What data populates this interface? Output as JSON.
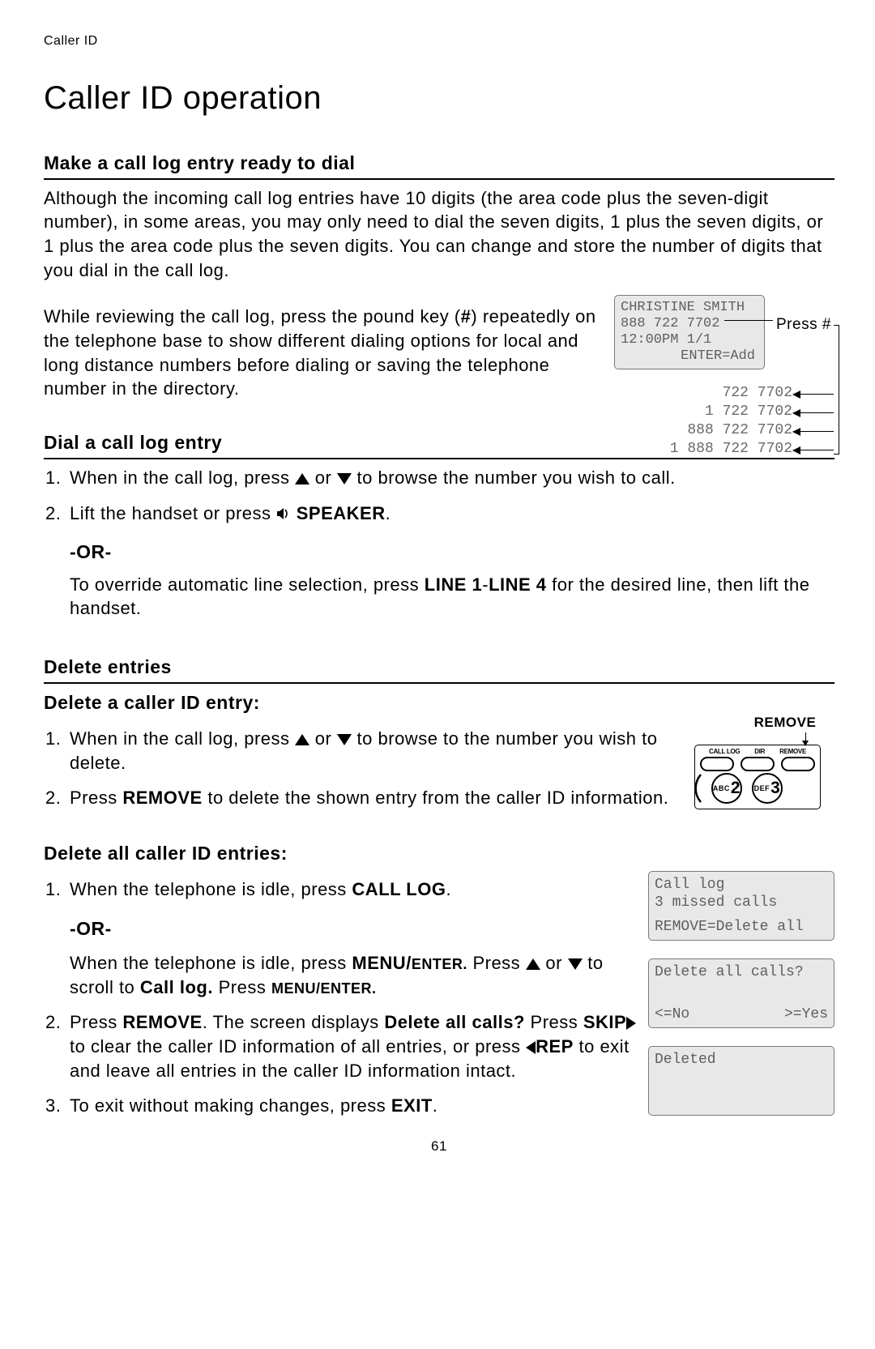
{
  "running_header": "Caller ID",
  "title": "Caller ID operation",
  "section1": {
    "heading": "Make a call log entry ready to dial",
    "para1": "Although the incoming call log entries have 10 digits (the area code plus the seven-digit number), in some areas, you may only need to dial the seven digits, 1 plus the seven digits, or 1 plus the area code plus the seven digits. You can change and store the number of digits that you dial in the call log.",
    "para2_pre": "While reviewing the call log, press the pound key (",
    "para2_pound": "#",
    "para2_post": ") repeatedly on the telephone base to show different dialing options for local and long distance numbers before dialing or saving the telephone number in the directory.",
    "press_label": "Press #"
  },
  "lcd1": {
    "line1": "CHRISTINE SMITH",
    "line2": "888 722 7702",
    "line3": "12:00PM 1/1",
    "line4": "ENTER=Add"
  },
  "dial_options": [
    "722 7702",
    "1 722 7702",
    "888 722 7702",
    "1 888 722 7702"
  ],
  "section2": {
    "heading": "Dial a call log entry",
    "step1_pre": "When in the call log, press ",
    "step1_mid": " or ",
    "step1_post": " to browse the number you wish to call.",
    "step2_pre": "Lift the handset or press ",
    "speaker_label": " SPEAKER",
    "step2_post": ".",
    "or": "-OR-",
    "step2b_pre": "To override automatic line selection, press ",
    "line_label": "LINE 1",
    "dash": "-",
    "line_label2": "LINE 4",
    "step2b_post": " for the desired line, then lift the handset."
  },
  "section3": {
    "heading": "Delete entries",
    "sub1": "Delete a caller ID entry:",
    "s1_step1_pre": "When in the call log, press ",
    "s1_step1_mid": " or ",
    "s1_step1_post": " to browse to the number you wish to delete.",
    "s1_step2_pre": "Press ",
    "remove_bold": "REMOVE",
    "s1_step2_post": " to delete the shown entry from the caller ID information.",
    "sub2": "Delete all caller ID entries:",
    "s2_step1_pre": "When the telephone is idle, press ",
    "calllog_bold": "CALL LOG",
    "s2_step1_post": ".",
    "or": "-OR-",
    "s2_step1b_pre": "When the telephone is idle, press ",
    "menu_enter_sc": "MENU/ENTER.",
    "s2_step1b_mid": " Press ",
    "s2_step1b_mid2": " or ",
    "s2_step1b_mid3": " to scroll to ",
    "calllog_bold2": "Call log.",
    "s2_step1b_post": " Press ",
    "menu_enter_sc2": "MENU/ENTER.",
    "s2_step2_pre": "Press ",
    "s2_step2_mid": ". The screen displays ",
    "delete_all_q": "Delete all calls?",
    "s2_step2_mid2": " Press ",
    "skip_bold": "SKIP",
    "s2_step2_mid3": " to clear the caller ID information of all entries, or press ",
    "rep_bold": "REP",
    "s2_step2_post": " to exit and leave all entries in the caller ID information intact.",
    "s2_step3_pre": "To exit without making changes, press ",
    "exit_bold": "EXIT",
    "s2_step3_post": "."
  },
  "keypad": {
    "remove_caption": "REMOVE",
    "labels": [
      "CALL LOG",
      "DIR",
      "REMOVE"
    ],
    "key2_letters": "ABC",
    "key2_num": "2",
    "key3_letters": "DEF",
    "key3_num": "3"
  },
  "lcd2": {
    "line1": "Call log",
    "line2": "3 missed calls",
    "line4": "REMOVE=Delete all"
  },
  "lcd3": {
    "line1": "Delete all calls?",
    "left": "<=No",
    "right": ">=Yes"
  },
  "lcd4": {
    "line1": "Deleted"
  },
  "page_number": "61"
}
